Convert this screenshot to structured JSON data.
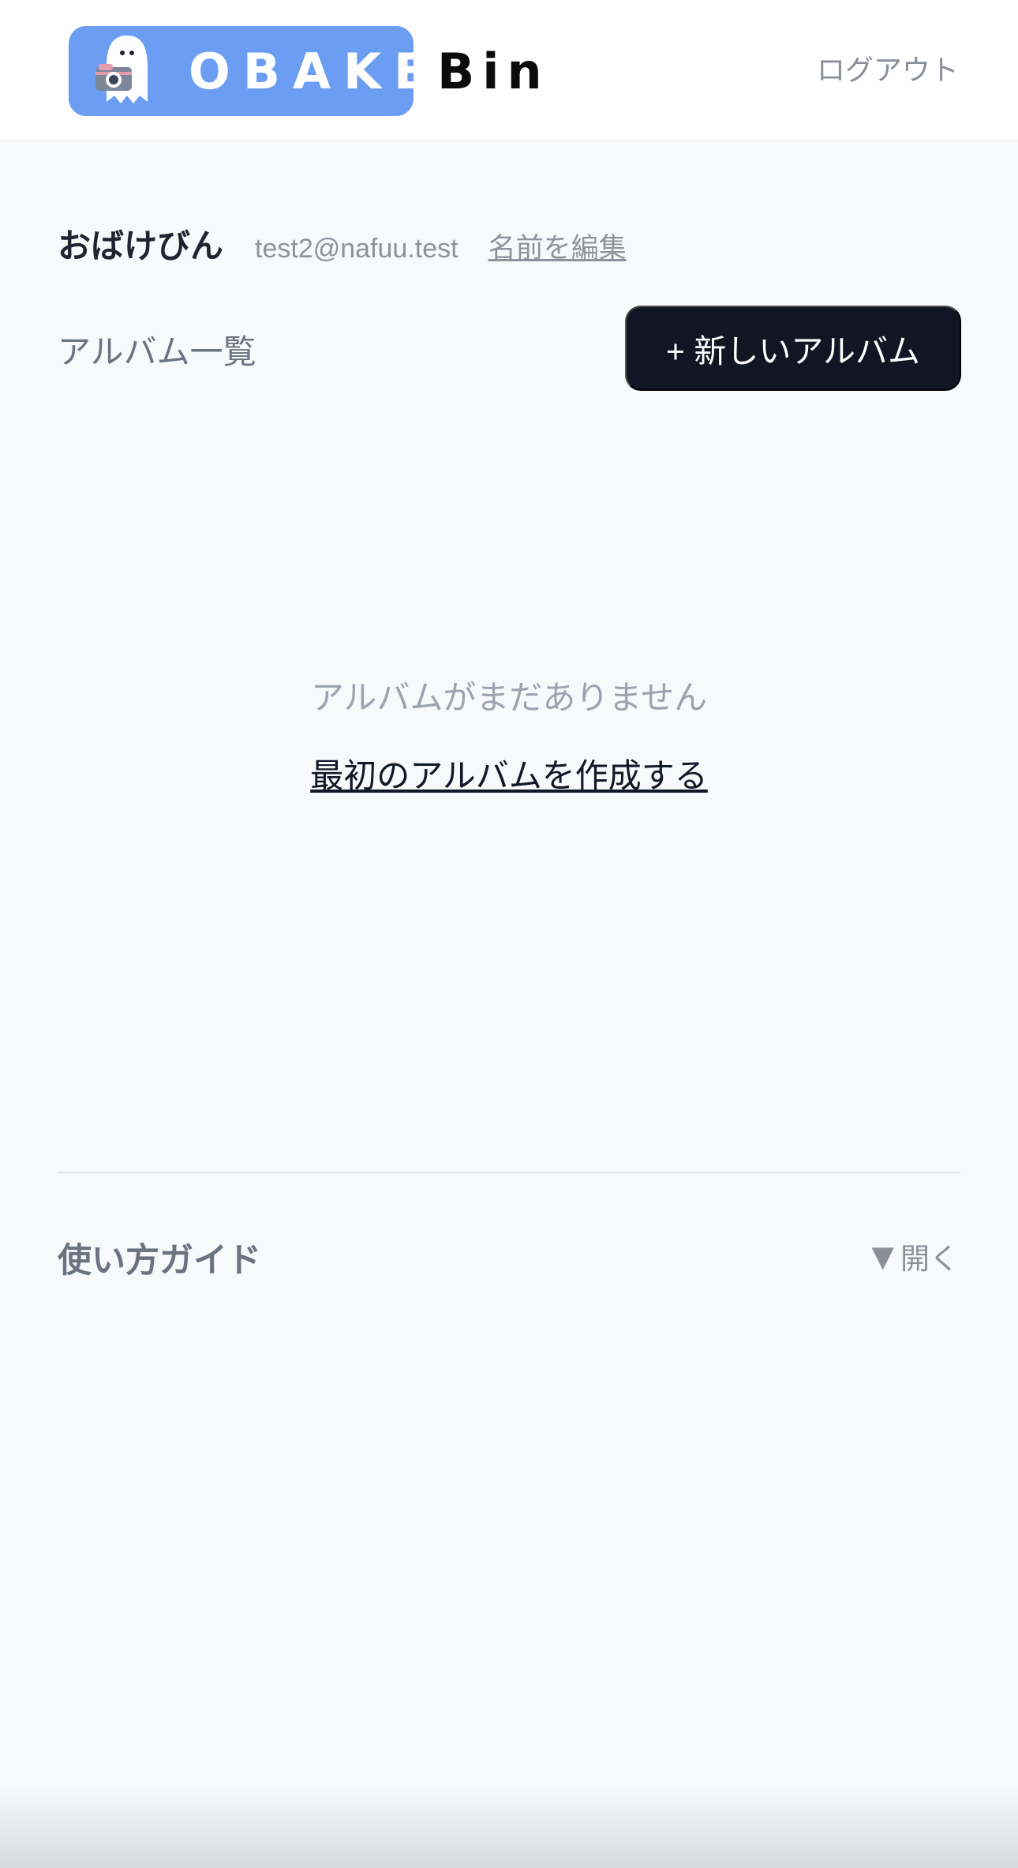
{
  "header": {
    "logo_text": "OBAKE",
    "logo_suffix": "Bin",
    "logout_label": "ログアウト"
  },
  "profile": {
    "name": "おばけびん",
    "email": "test2@nafuu.test",
    "edit_label": "名前を編集"
  },
  "albums": {
    "section_title": "アルバム一覧",
    "new_album_label": "+ 新しいアルバム",
    "empty_text": "アルバムがまだありません",
    "create_first_label": "最初のアルバムを作成する"
  },
  "guide": {
    "title": "使い方ガイド",
    "toggle_icon": "▼",
    "toggle_label": "開く"
  },
  "colors": {
    "brand": "#6b9ef3",
    "primary_button": "#121624",
    "background": "#f8f9fb"
  },
  "icons": {
    "logo": "ghost-with-camera-icon",
    "guide_toggle": "triangle-down-icon"
  }
}
